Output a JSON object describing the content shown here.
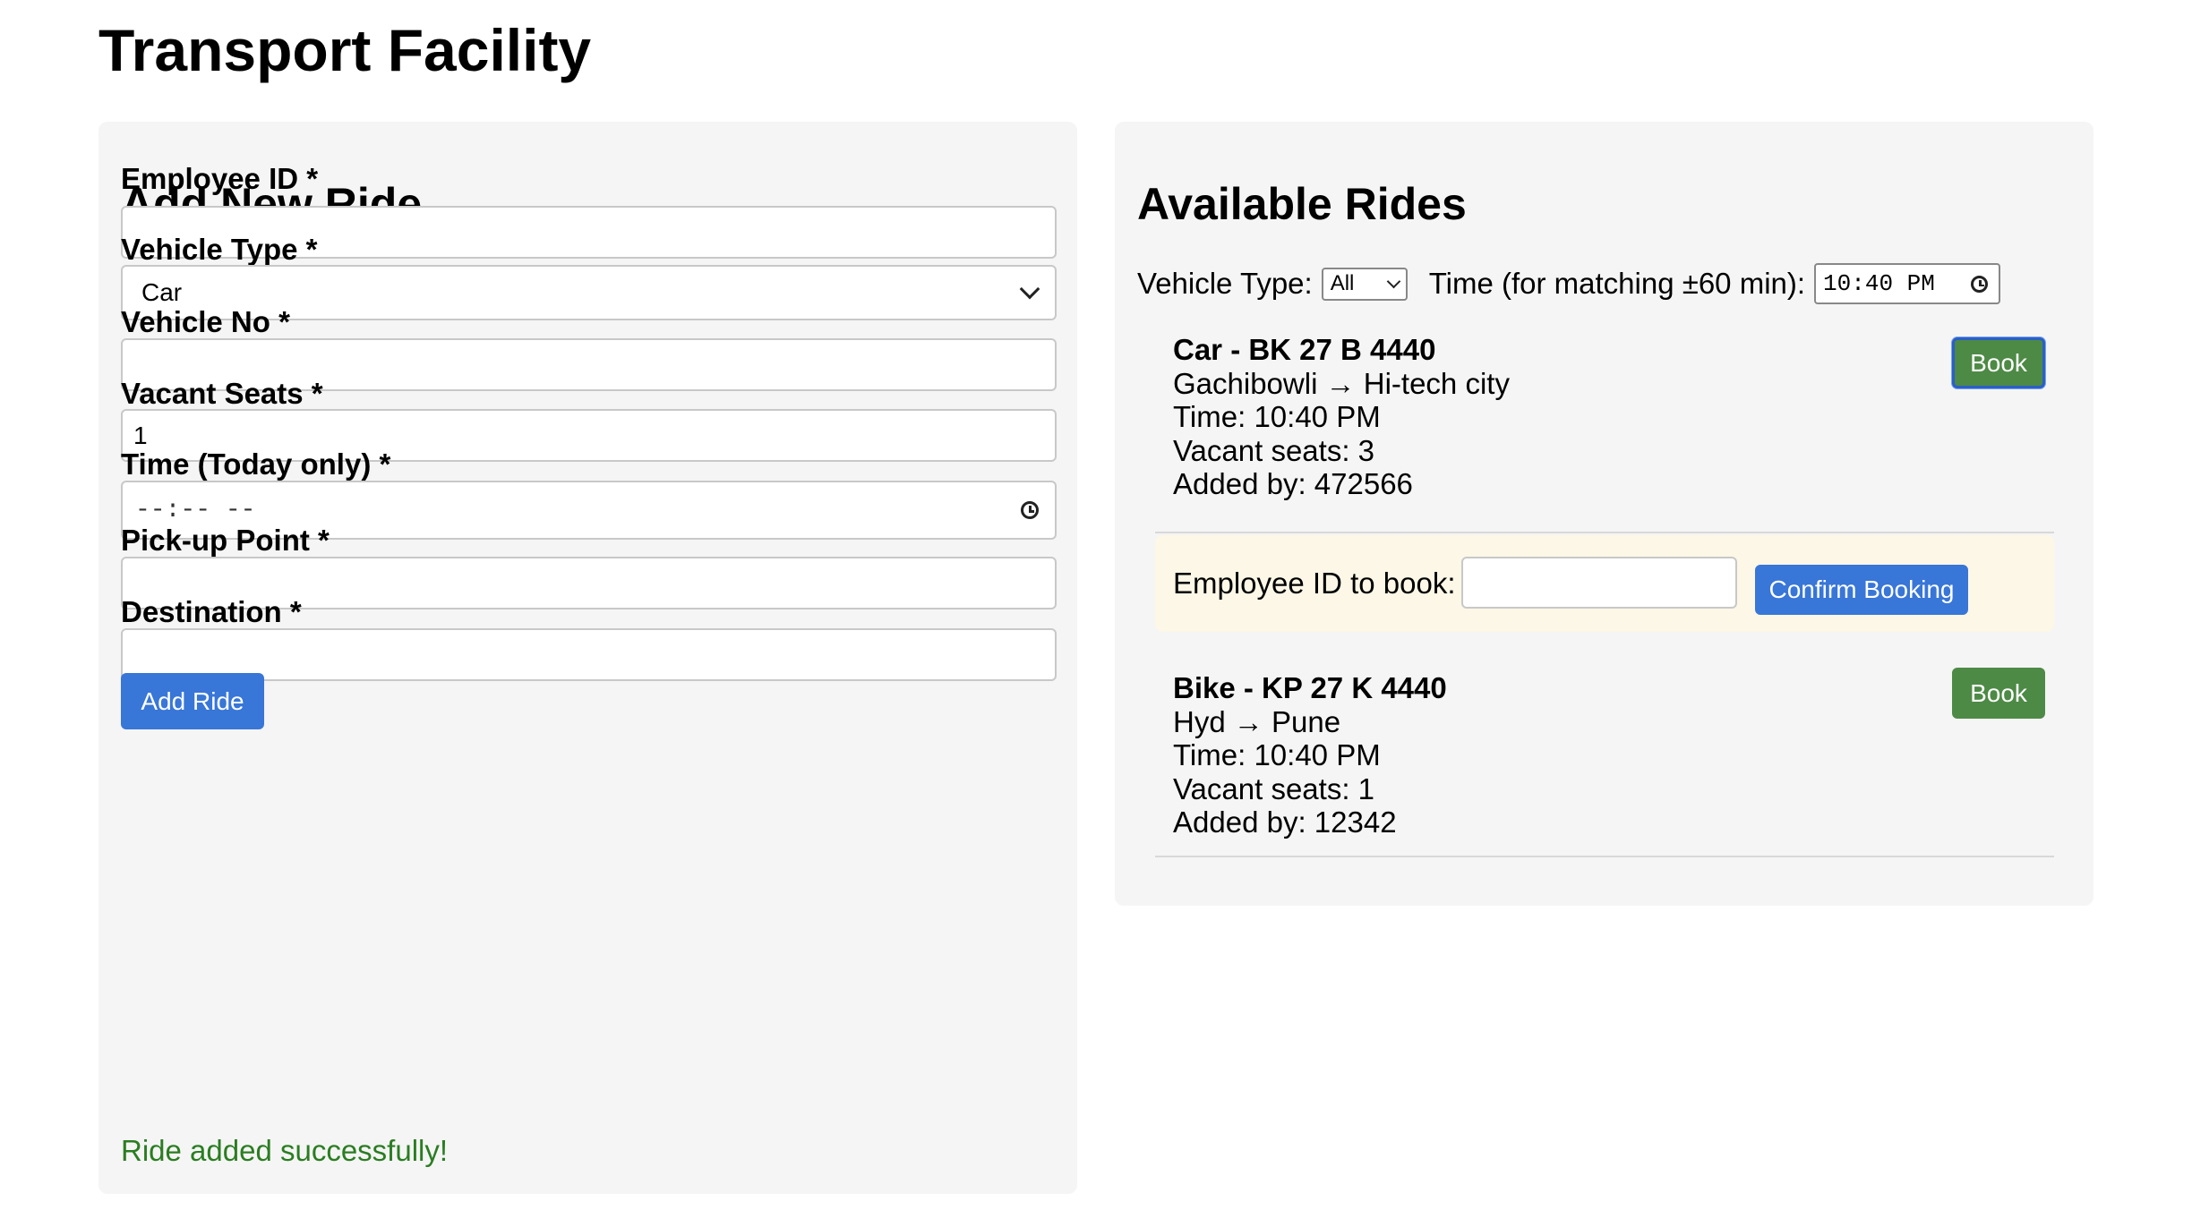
{
  "page": {
    "title": "Transport Facility"
  },
  "add_ride": {
    "title": "Add New Ride",
    "employee_id": {
      "label": "Employee ID *",
      "value": ""
    },
    "vehicle_type": {
      "label": "Vehicle Type *",
      "value": "Car"
    },
    "vehicle_no": {
      "label": "Vehicle No *",
      "value": ""
    },
    "vacant_seats": {
      "label": "Vacant Seats *",
      "value": "1"
    },
    "time": {
      "label": "Time (Today only) *",
      "value": "--:-- --"
    },
    "pickup_point": {
      "label": "Pick-up Point *",
      "value": ""
    },
    "destination": {
      "label": "Destination *",
      "value": ""
    },
    "submit_label": "Add Ride",
    "success_message": "Ride added successfully!"
  },
  "available_rides": {
    "title": "Available Rides",
    "filter": {
      "vehicle_type_label": "Vehicle Type:",
      "vehicle_type_value": "All",
      "time_label": "Time (for matching ±60 min):",
      "time_value": "10:40 PM"
    },
    "rides": [
      {
        "title": "Car - BK 27 B 4440",
        "route": "Gachibowli → Hi-tech city",
        "time": "Time: 10:40 PM",
        "seats": "Vacant seats: 3",
        "added_by": "Added by: 472566",
        "book_label": "Book"
      },
      {
        "title": "Bike - KP 27 K 4440",
        "route": "Hyd → Pune",
        "time": "Time: 10:40 PM",
        "seats": "Vacant seats: 1",
        "added_by": "Added by: 12342",
        "book_label": "Book"
      }
    ],
    "booking": {
      "label": "Employee ID to book:",
      "value": "",
      "confirm_label": "Confirm Booking"
    }
  },
  "colors": {
    "primary_button": "#3876d8",
    "book_button": "#4d8a45",
    "success_text": "#2a7d21",
    "panel_background": "#f5f5f5",
    "booking_background": "#fcf7e6"
  },
  "icons": {
    "time_field": "clock-icon",
    "select": "chevron-down-icon"
  }
}
